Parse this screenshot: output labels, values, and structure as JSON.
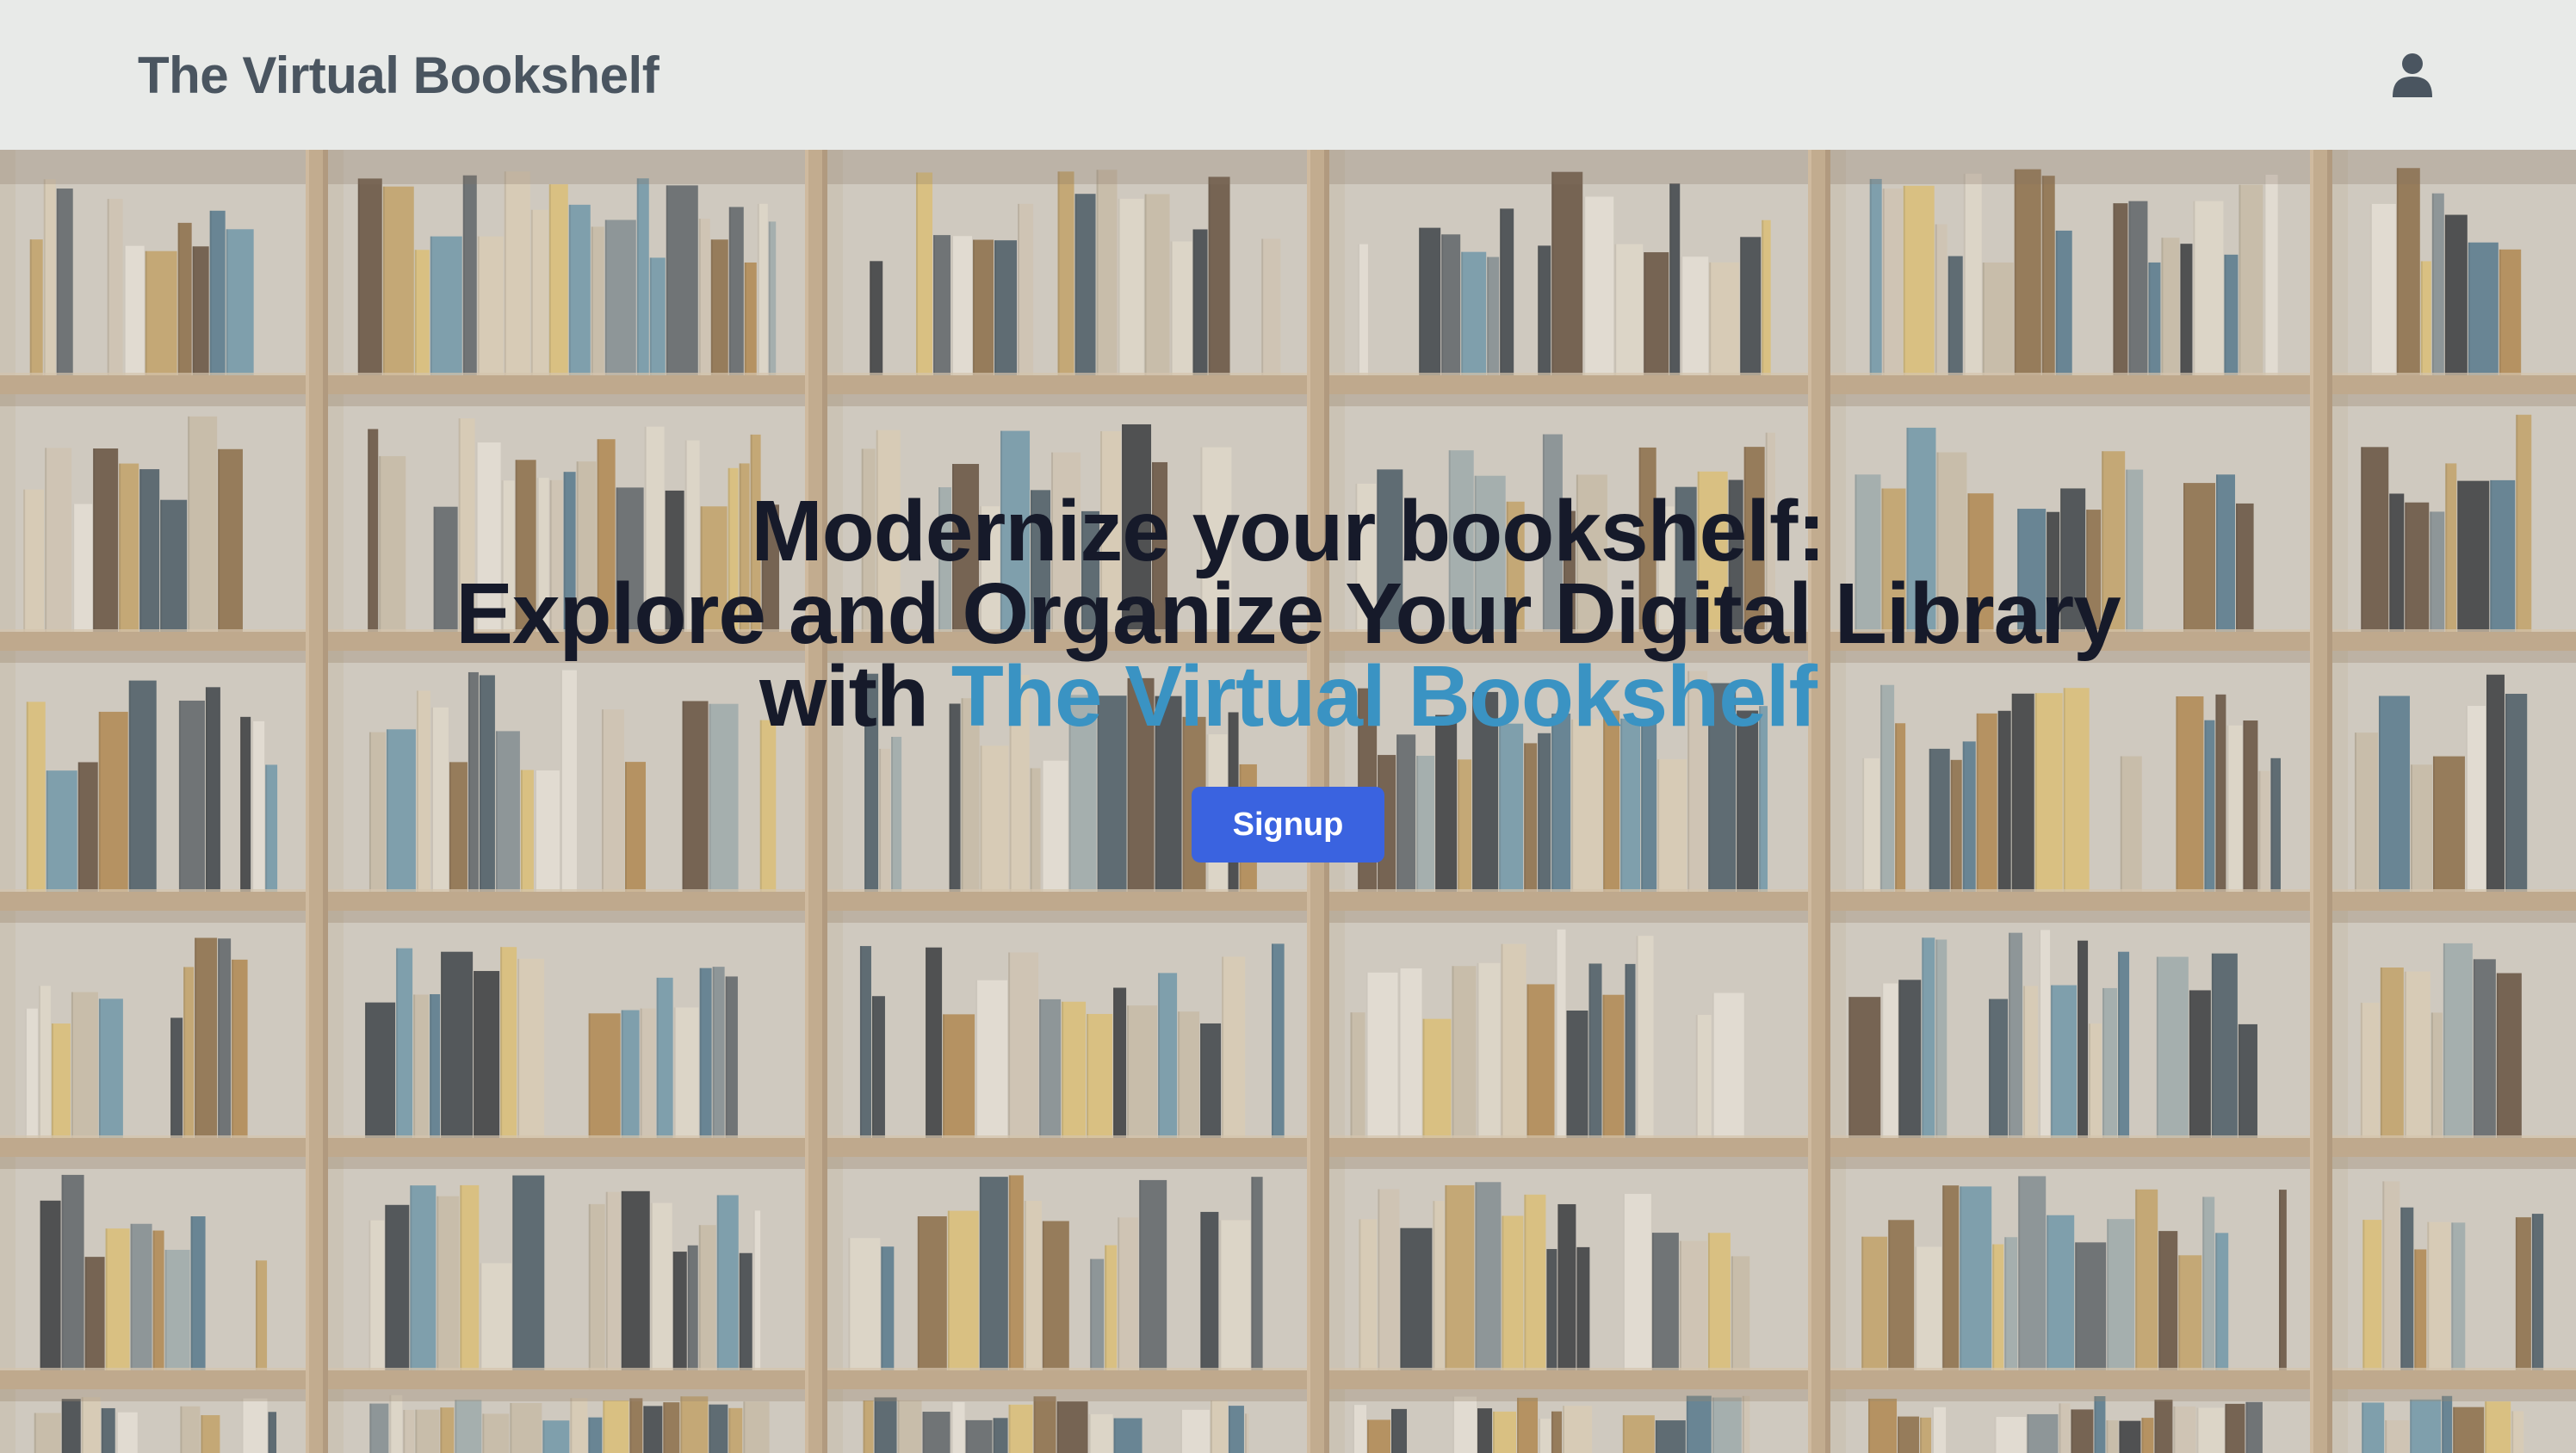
{
  "navbar": {
    "brand": "The Virtual Bookshelf",
    "user_icon": "user-icon"
  },
  "hero": {
    "headline_line1": "Modernize your bookshelf:",
    "headline_line2": "Explore and Organize Your Digital Library",
    "headline_with": "with ",
    "headline_accent": "The Virtual Bookshelf",
    "signup_label": "Signup",
    "background": "bookshelf-photo"
  },
  "colors": {
    "navbar_bg": "#e8eae8",
    "brand_text": "#4a5560",
    "headline_text": "#161a2a",
    "accent": "#3a93c3",
    "button": "#3a63e0"
  }
}
